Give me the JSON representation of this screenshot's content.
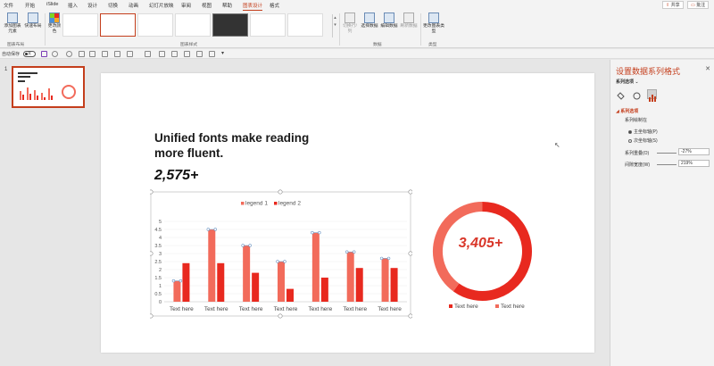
{
  "menu": {
    "tabs": [
      "文件",
      "开始",
      "iSlide",
      "插入",
      "设计",
      "切换",
      "动画",
      "幻灯片放映",
      "审阅",
      "视图",
      "帮助",
      "图表设计",
      "格式"
    ],
    "active": "图表设计",
    "share": "共享",
    "comment": "批注"
  },
  "ribbon": {
    "add_element": "添加图表元素",
    "quick_layout": "快速布局",
    "change_colors": "更改颜色",
    "group_layout": "图表布局",
    "group_styles": "图表样式",
    "switch_rowcol": "切换行/列",
    "select_data": "选择数据",
    "edit_data": "编辑数据",
    "refresh_data": "刷新数据",
    "group_data": "数据",
    "change_type": "更改图表类型",
    "group_type": "类型"
  },
  "qat": {
    "autosave": "自动保存",
    "autosave_state": "关"
  },
  "thumbnails": {
    "slide_number": "1"
  },
  "slide": {
    "title": "Unified fonts make reading more fluent.",
    "stat": "2,575+",
    "donut_value": "3,405+",
    "donut_legend": [
      "Text here",
      "Text here"
    ]
  },
  "chart_data": {
    "type": "bar",
    "title": "",
    "categories": [
      "Text here",
      "Text here",
      "Text here",
      "Text here",
      "Text here",
      "Text here",
      "Text here"
    ],
    "series": [
      {
        "name": "legend 1",
        "values": [
          1.3,
          4.5,
          3.5,
          2.5,
          4.3,
          3.1,
          2.7
        ]
      },
      {
        "name": "legend 2",
        "values": [
          2.4,
          2.4,
          1.8,
          0.8,
          1.5,
          2.1,
          2.1
        ]
      }
    ],
    "ylim": [
      0,
      5
    ],
    "yticks": [
      "0",
      "0.5",
      "1",
      "1.5",
      "2",
      "2.5",
      "3",
      "3.5",
      "4",
      "4.5",
      "5"
    ],
    "legend_position": "top",
    "grid": true
  },
  "donut_data": {
    "type": "pie",
    "values": [
      60,
      40
    ]
  },
  "colors": {
    "series1": "#f26b5b",
    "series2": "#e8291f",
    "accent": "#c43e1c"
  },
  "panel": {
    "title": "设置数据系列格式",
    "subtitle": "系列选项",
    "section": "系列选项",
    "plot_on": "系列绘制在",
    "primary_axis": "主坐标轴(P)",
    "secondary_axis": "次坐标轴(S)",
    "overlap_label": "系列重叠(O)",
    "overlap_value": "-27%",
    "gap_label": "间隙宽度(W)",
    "gap_value": "219%"
  }
}
